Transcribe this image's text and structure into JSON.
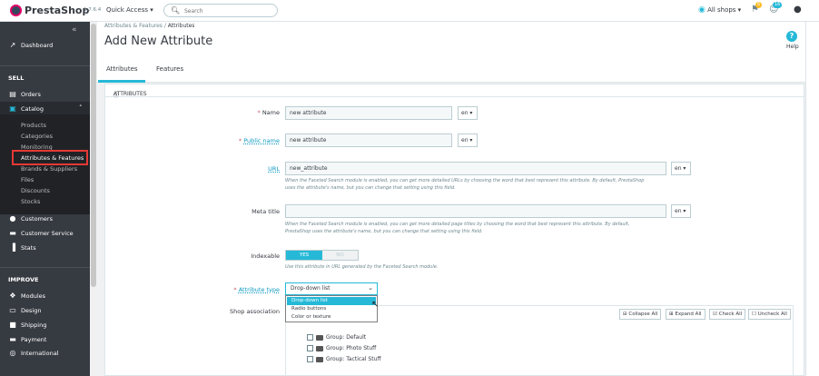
{
  "topbar": {
    "logo": "PrestaShop",
    "version": "1.7.6.4",
    "quick_access": "Quick Access ▾",
    "search_placeholder": "Search",
    "shops": "All shops ▾",
    "notif_orders": "6",
    "notif_customers": "16"
  },
  "sidebar": {
    "dashboard": "Dashboard",
    "sell_header": "SELL",
    "orders": "Orders",
    "catalog": "Catalog",
    "catalog_sub": [
      "Products",
      "Categories",
      "Monitoring",
      "Attributes & Features",
      "Brands & Suppliers",
      "Files",
      "Discounts",
      "Stocks"
    ],
    "customers": "Customers",
    "customer_service": "Customer Service",
    "stats": "Stats",
    "improve_header": "IMPROVE",
    "modules": "Modules",
    "design": "Design",
    "shipping": "Shipping",
    "payment": "Payment",
    "international": "International"
  },
  "header": {
    "breadcrumb_1": "Attributes & Features",
    "breadcrumb_sep": "/",
    "breadcrumb_2": "Attributes",
    "title": "Add New Attribute",
    "help": "Help",
    "tabs": [
      "Attributes",
      "Features"
    ]
  },
  "form": {
    "panel_title": "ATTRIBUTES",
    "name_label": "Name",
    "name_value": "new attribute",
    "public_name_label": "Public name",
    "public_name_value": "new attribute",
    "url_label": "URL",
    "url_value": "new_attribute",
    "url_help_1": "When the Faceted Search module is enabled, you can get more detailed URLs by choosing the word that best represent this attribute. By default, PrestaShop",
    "url_help_2": "uses the attribute's name, but you can change that setting using this field.",
    "meta_label": "Meta title",
    "meta_value": "",
    "meta_help_1": "When the Faceted Search module is enabled, you can get more detailed page titles by choosing the word that best represent this attribute. By default,",
    "meta_help_2": "PrestaShop uses the attribute's name, but you can change that setting using this field.",
    "lang": "en ▾",
    "indexable_label": "Indexable",
    "yes": "YES",
    "no": "NO",
    "indexable_help": "Use this attribute in URL generated by the Faceted Search module.",
    "type_label": "Attribute type",
    "type_value": "Drop-down list",
    "type_options": [
      "Drop-down list",
      "Radio buttons",
      "Color or texture"
    ],
    "shop_label": "Shop association",
    "collapse_all": "Collapse All",
    "expand_all": "Expand All",
    "check_all": "Check All",
    "uncheck_all": "Uncheck All",
    "groups": [
      "Group: Default",
      "Group: Photo Stuff",
      "Group: Tactical Stuff"
    ]
  },
  "colors": {
    "accent": "#25b9d7",
    "sidebar": "#363a41",
    "highlight": "#e53935"
  }
}
